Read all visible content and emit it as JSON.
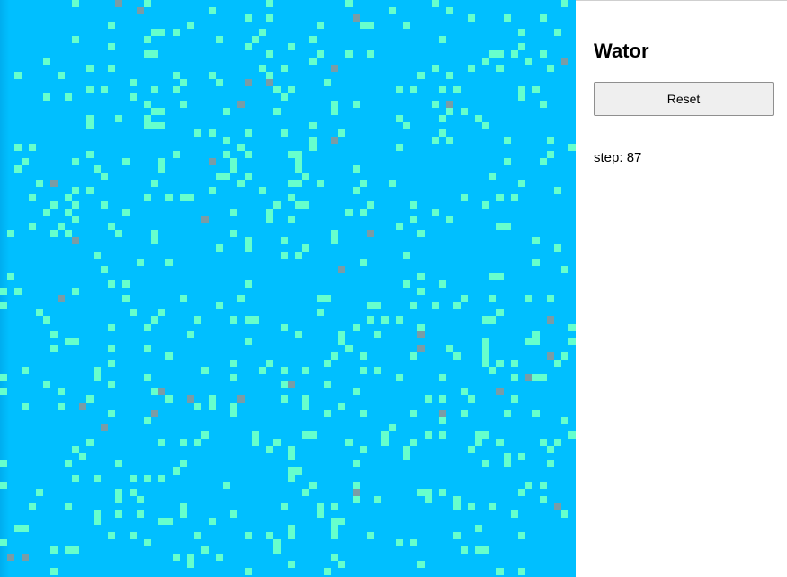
{
  "title": "Wator",
  "controls": {
    "reset_label": "Reset"
  },
  "status": {
    "step_label": "step:",
    "step_value": "87"
  },
  "colors": {
    "water": "#00bfff",
    "fish": "#66ffcc",
    "shark": "#7a9ca6"
  },
  "legend": {
    "fish_icon": "fish-cell",
    "shark_icon": "shark-cell"
  }
}
